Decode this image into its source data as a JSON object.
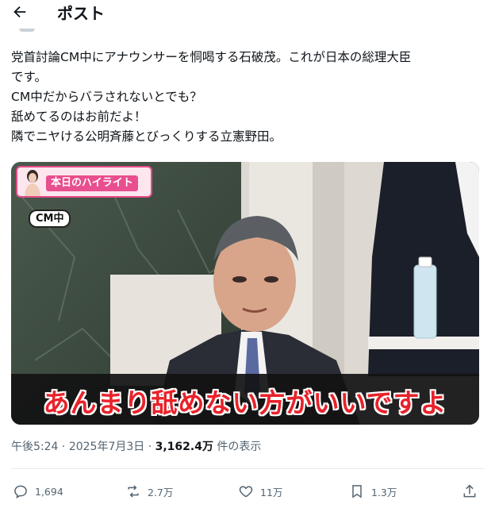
{
  "header": {
    "title": "ポスト"
  },
  "post": {
    "lines": [
      "党首討論CM中にアナウンサーを恫喝する石破茂。これが日本の総理大臣",
      "です。",
      "CM中だからバラされないとでも？",
      "舐めてるのはお前だよ！",
      "隣でニヤける公明斉藤とびっくりする立憲野田。"
    ]
  },
  "media": {
    "badge": "本日のハイライト",
    "cm_tag": "CM中",
    "subtitle": "あんまり舐めない方がいいですよ"
  },
  "meta": {
    "time": "午後5:24",
    "sep1": " · ",
    "date": "2025年7月3日",
    "sep2": " · ",
    "views": "3,162.4万",
    "views_suffix": " 件の表示"
  },
  "actions": {
    "replies": "1,694",
    "reposts": "2.7万",
    "likes": "11万",
    "bookmarks": "1.3万"
  },
  "icons": [
    "back-arrow-icon",
    "reply-icon",
    "repost-icon",
    "like-icon",
    "bookmark-icon",
    "share-icon"
  ],
  "colors": {
    "accent_pink": "#e84f8e",
    "subtitle_red": "#e8222a",
    "muted": "#536471"
  }
}
